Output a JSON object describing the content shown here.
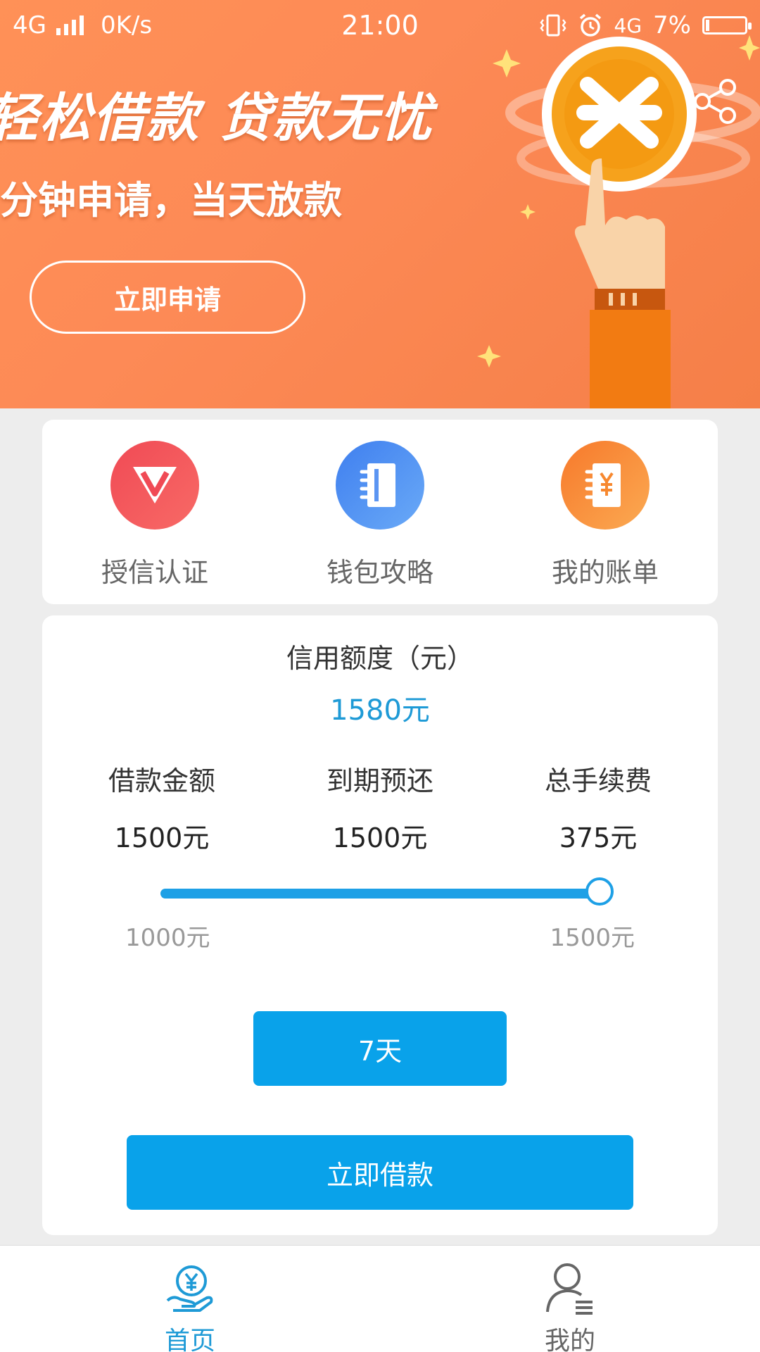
{
  "status_bar": {
    "network": "4G",
    "speed": "0K/s",
    "time": "21:00",
    "network_right": "4G",
    "battery": "7%"
  },
  "banner": {
    "title": "轻松借款  贷款无忧",
    "subtitle": "分钟申请，当天放款",
    "apply_label": "立即申请"
  },
  "quick_menu": {
    "items": [
      {
        "label": "授信认证",
        "icon": "diamond-v-icon",
        "color": "#f04a55"
      },
      {
        "label": "钱包攻略",
        "icon": "notebook-icon",
        "color": "#4d8ff3"
      },
      {
        "label": "我的账单",
        "icon": "bill-yen-icon",
        "color": "#f7882f"
      }
    ]
  },
  "loan": {
    "credit_title": "信用额度（元）",
    "credit_value": "1580元",
    "stats": [
      {
        "label": "借款金额",
        "value": "1500元"
      },
      {
        "label": "到期预还",
        "value": "1500元"
      },
      {
        "label": "总手续费",
        "value": "375元"
      }
    ],
    "slider": {
      "min_label": "1000元",
      "max_label": "1500元",
      "min": 1000,
      "max": 1500,
      "value": 1500
    },
    "period_label": "7天",
    "borrow_label": "立即借款"
  },
  "tabbar": {
    "tabs": [
      {
        "label": "首页",
        "icon": "yen-hand-icon",
        "active": true
      },
      {
        "label": "我的",
        "icon": "user-icon",
        "active": false
      }
    ],
    "active_color": "#1e9ad6",
    "inactive_color": "#666666"
  }
}
